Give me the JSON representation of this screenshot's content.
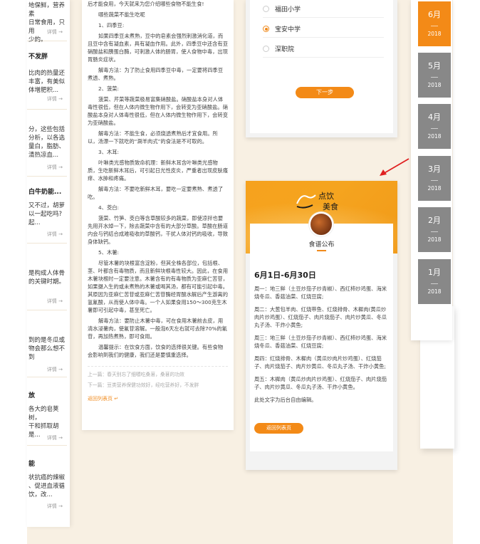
{
  "left_cards": [
    {
      "lines": [
        "地保鲜，营养素",
        "日常食用，只用",
        "少的。"
      ],
      "more": "详情 →"
    },
    {
      "title": "不发胖",
      "lines": [
        "比肉的热量还",
        "丰富，有美似",
        "体增肥积..."
      ],
      "more": "详情 →"
    },
    {
      "lines": [
        "分，这些包括",
        "分析，以各选",
        "量白，脂肪、",
        "清热凉血..."
      ],
      "more": "详情 →"
    },
    {
      "title": "白牛奶能...",
      "lines": [
        "又不过，胡萝",
        "以一起吃吗?",
        "起..."
      ],
      "more": "详情 →"
    },
    {
      "lines": [
        "是构成人体骨",
        "的关键时期。"
      ],
      "more": "详情 →"
    },
    {
      "lines": [
        "到的是冬瓜或",
        "物会那么想不到"
      ],
      "more": "详情 →"
    },
    {
      "title": "放",
      "lines": [
        "各大的皂荚树，",
        "干和抓取胡",
        "是..."
      ],
      "more": "详情 →"
    },
    {
      "title": "能",
      "lines": [
        "状抗癌的辣椒",
        "、促进血液循",
        "饮，改..."
      ],
      "more": "详情 →"
    }
  ],
  "article": {
    "paragraphs": [
      "后才能食用，今天就来为您介绍哪些食物不能生食!",
      "哪些蔬菜不能生吃呢",
      "1、四季豆:",
      "如果四季豆未煮熟，豆中的皂素会强烈刺激消化道，而且豆中含有凝血素，具有凝血作用。此外，四季豆中还含有亚硝酸盐和胰蛋白酶，可刺激人体的肠胃，使人食物中毒，出现胃肠炎症状。",
      "解毒方法：为了防止食用四季豆中毒，一定要将四季豆煮透、煮熟。",
      "2、菠菜:",
      "菠菜、芹菜等蔬菜极易富集硝酸盐。硝酸盐本身对人体毒性很低，但在人体内微生物作用下，会转变为亚硝酸盐。硝酸盐本身对人体毒性很低，但在人体内微生物作用下，会转变为亚硝酸盐。",
      "解毒方法：不能生食，必须烧透煮熟后才宜食用。所以，汤漂一下就吃的“涮羊肉式”的食法是不可取的。",
      "3、木耳:",
      "叶啉类光感物质致命机理：新鲜木耳含叶啉类光感物质，生吃新鲜木耳后，可引起日光性皮炎，严重者出现皮肤瘙痒、水肿和疼痛。",
      "解毒方法：不要吃新鲜木耳，要吃一定要煮熟、煮透了吃。",
      "4、茭白:",
      "菠菜、竹笋、茭白等含草酸较多的蔬菜，即使凉拌也要先用开水焯一下，除去蔬菜中含有的大部分草酸。草酸在肠道内会与钙结合成难吸收的草酸钙，干扰人体对钙的吸收，导致身体缺钙。",
      "5、木薯:",
      "尽管木薯的块根富含淀粉，但其全株各部位，包括根、茎、叶都含有毒物质，而且新鲜块根毒性较大。因此，在食用木薯块根时一定要注意。木薯含有的有毒物质为亚麻仁苦苷，如果摄入生的或未煮熟的木薯或喝其汤，都有可能引起中毒。其原因为亚麻仁苦苷或亚麻仁苦苷酶经胃酸水解后产生游离的氢氰酸，从而使人体中毒。一个人如果食用150～300克生木薯即可引起中毒，甚至死亡。",
      "解毒方法：要防止木薯中毒，可在食用木薯前去皮，用清水浸薯肉，使氰苷溶解。一般泡6天左右就可去除70%的氰苷，再加热煮熟，即可食用。",
      "温馨提示：在饮食方面，饮食的选择很关键。有些食物会影响到我们的健康，我们还是要慎重选择。"
    ],
    "prev": "上一篇：春天别忘了细嚼吃桑葚，桑葚的功效",
    "next": "下一篇：豆类营养保健功效好，经吃营养好，不发胖",
    "back": "返回列表页"
  },
  "vote": {
    "options": [
      {
        "label": "福田小学",
        "selected": false
      },
      {
        "label": "宝安中学",
        "selected": true
      },
      {
        "label": "深职院",
        "selected": false
      }
    ],
    "next_button": "下一步"
  },
  "menu_card": {
    "logo_text": "点饮美食",
    "title": "食谱公布",
    "date_range": "6月1日-6月30日",
    "days": [
      "周一：地三鲜（土豆炒茄子炒青椒）、西红柿炒鸡蛋、海米烧冬瓜、香菇油菜、红烧豆腐;",
      "周二：大葱包羊肉、红烧带鱼、红烧排骨、木樨肉(黄瓜炒肉片炒鸡蛋）、红烧茄子、肉片烧茄子、肉片炒黄瓜、冬瓜丸子汤、干炸小黄鱼;",
      "周三：地三鲜（土豆炒茄子炒青椒）、西红柿炒鸡蛋、海米烧冬瓜、香菇油菜、红烧豆腐;",
      "周四：红烧排骨、木樨肉（黄瓜炒肉片炒鸡蛋）、红烧茄子、肉片烧茄子、肉片炒黄瓜、冬瓜丸子汤、干炸小黄鱼;",
      "周五：木樨肉（黄瓜炒肉片炒鸡蛋）、红烧茄子、肉片烧茄子、肉片炒黄瓜、冬瓜丸子汤、干炸小黄鱼。"
    ],
    "note": "此处文字为后台自由编辑。",
    "back_button": "返回列表页"
  },
  "months": [
    {
      "month": "6月",
      "year": "2018",
      "active": true
    },
    {
      "month": "5月",
      "year": "2018",
      "active": false
    },
    {
      "month": "4月",
      "year": "2018",
      "active": false
    },
    {
      "month": "3月",
      "year": "2018",
      "active": false
    },
    {
      "month": "2月",
      "year": "2018",
      "active": false
    },
    {
      "month": "1月",
      "year": "2018",
      "active": false
    }
  ],
  "colors": {
    "accent": "#f38a17",
    "month_inactive": "#888888",
    "background": "#f8f0e3",
    "arrow": "#e02020"
  }
}
